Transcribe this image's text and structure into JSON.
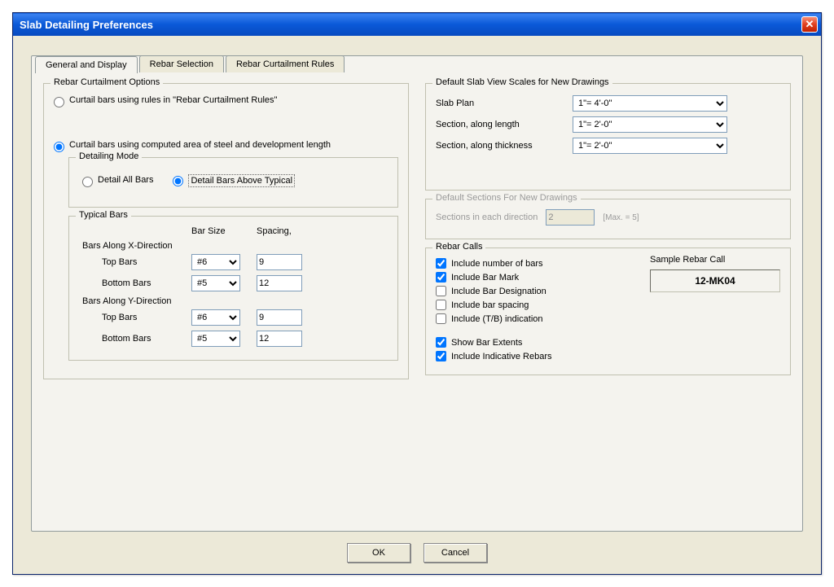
{
  "window": {
    "title": "Slab Detailing Preferences"
  },
  "tabs": {
    "general": "General and Display",
    "rebar_selection": "Rebar Selection",
    "curtailment_rules": "Rebar Curtailment Rules"
  },
  "curtailment": {
    "legend": "Rebar Curtailment Options",
    "opt_rules": "Curtail bars using rules in \"Rebar Curtailment Rules\"",
    "opt_computed": "Curtail bars using computed area of steel and development length"
  },
  "detailing_mode": {
    "legend": "Detailing Mode",
    "opt_all": "Detail All Bars",
    "opt_above": "Detail Bars Above Typical"
  },
  "typical_bars": {
    "legend": "Typical Bars",
    "col_bar_size": "Bar Size",
    "col_spacing": "Spacing,",
    "x_head": "Bars Along X-Direction",
    "y_head": "Bars Along Y-Direction",
    "top_label": "Top Bars",
    "bottom_label": "Bottom Bars",
    "x_top_size": "#6",
    "x_top_spacing": "9",
    "x_bot_size": "#5",
    "x_bot_spacing": "12",
    "y_top_size": "#6",
    "y_top_spacing": "9",
    "y_bot_size": "#5",
    "y_bot_spacing": "12"
  },
  "scales": {
    "legend": "Default Slab View Scales for New Drawings",
    "slab_plan_label": "Slab Plan",
    "slab_plan_value": "1\"= 4'-0\"",
    "section_length_label": "Section, along length",
    "section_length_value": "1\"= 2'-0\"",
    "section_thickness_label": "Section, along thickness",
    "section_thickness_value": "1\"= 2'-0\""
  },
  "sections": {
    "legend": "Default Sections For New Drawings",
    "label": "Sections in each direction",
    "value": "2",
    "hint": "[Max. = 5]"
  },
  "rebar_calls": {
    "legend": "Rebar Calls",
    "include_num": "Include number of bars",
    "include_mark": "Include Bar Mark",
    "include_desig": "Include Bar Designation",
    "include_spacing": "Include bar spacing",
    "include_tb": "Include (T/B) indication",
    "show_extents": "Show Bar Extents",
    "include_indicative": "Include Indicative Rebars",
    "sample_label": "Sample Rebar Call",
    "sample_value": "12-MK04"
  },
  "buttons": {
    "ok": "OK",
    "cancel": "Cancel"
  }
}
